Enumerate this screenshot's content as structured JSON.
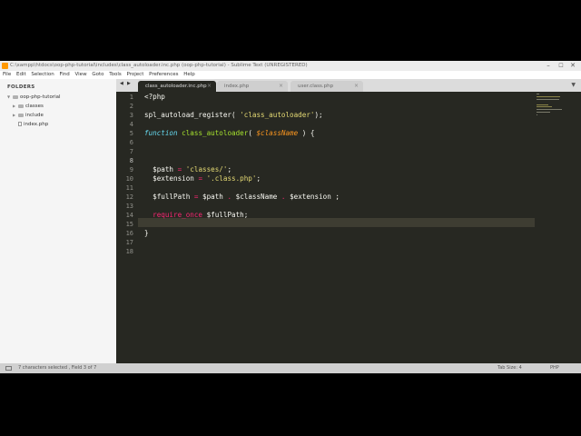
{
  "window": {
    "title": "C:\\xampp\\htdocs\\oop-php-tutorial\\includes\\class_autoloader.inc.php (oop-php-tutorial) - Sublime Text (UNREGISTERED)",
    "controls": {
      "minimize": "–",
      "maximize": "☐",
      "close": "✕"
    }
  },
  "menubar": [
    "File",
    "Edit",
    "Selection",
    "Find",
    "View",
    "Goto",
    "Tools",
    "Project",
    "Preferences",
    "Help"
  ],
  "sidebar": {
    "header": "FOLDERS",
    "root": "oop-php-tutorial",
    "items": [
      {
        "label": "classes",
        "type": "folder"
      },
      {
        "label": "include",
        "type": "folder"
      },
      {
        "label": "index.php",
        "type": "file"
      }
    ]
  },
  "tabs": [
    {
      "label": "class_autoloader.inc.php",
      "active": true
    },
    {
      "label": "index.php",
      "active": false
    },
    {
      "label": "user.class.php",
      "active": false
    }
  ],
  "tab_nav": {
    "left": "◀",
    "right": "▶",
    "menu": "▼",
    "close": "×"
  },
  "editor": {
    "current_line": 8,
    "line_numbers": [
      "1",
      "2",
      "3",
      "4",
      "5",
      "6",
      "7",
      "8",
      "9",
      "10",
      "11",
      "12",
      "13",
      "14",
      "15",
      "16",
      "17",
      "18"
    ],
    "lines": [
      [
        {
          "t": "<?php",
          "c": "white"
        }
      ],
      [],
      [
        {
          "t": "spl_autoload_register",
          "c": "cyan2"
        },
        {
          "t": "( ",
          "c": "white"
        },
        {
          "t": "'class_autoloader'",
          "c": "yellow"
        },
        {
          "t": ");",
          "c": "white"
        }
      ],
      [],
      [
        {
          "t": "function",
          "c": "cyan"
        },
        {
          "t": " ",
          "c": "white"
        },
        {
          "t": "class_autoloader",
          "c": "green"
        },
        {
          "t": "( ",
          "c": "white"
        },
        {
          "t": "$className",
          "c": "orange"
        },
        {
          "t": " ) {",
          "c": "white"
        }
      ],
      [],
      [],
      [],
      [
        {
          "t": "  $path ",
          "c": "white"
        },
        {
          "t": "=",
          "c": "pink"
        },
        {
          "t": " ",
          "c": "white"
        },
        {
          "t": "'classes/'",
          "c": "yellow"
        },
        {
          "t": ";",
          "c": "white"
        }
      ],
      [
        {
          "t": "  $extension ",
          "c": "white"
        },
        {
          "t": "=",
          "c": "pink"
        },
        {
          "t": " ",
          "c": "white"
        },
        {
          "t": "'.class.php'",
          "c": "yellow"
        },
        {
          "t": ";",
          "c": "white"
        }
      ],
      [],
      [
        {
          "t": "  $fullPath ",
          "c": "white"
        },
        {
          "t": "=",
          "c": "pink"
        },
        {
          "t": " $path ",
          "c": "white"
        },
        {
          "t": ".",
          "c": "pink"
        },
        {
          "t": " $className ",
          "c": "white"
        },
        {
          "t": ".",
          "c": "pink"
        },
        {
          "t": " $extension ;",
          "c": "white"
        }
      ],
      [],
      [
        {
          "t": "  require_once",
          "c": "pink"
        },
        {
          "t": " $fullPath;",
          "c": "white"
        }
      ],
      [],
      [
        {
          "t": "}",
          "c": "white"
        }
      ],
      [],
      []
    ]
  },
  "statusbar": {
    "message": "7 characters selected , Field 3 of 7",
    "tab_size": "Tab Size: 4",
    "syntax": "PHP"
  },
  "colors": {
    "background": "#272822",
    "keyword": "#f92672",
    "function_name": "#a6e22e",
    "string": "#e6db74",
    "storage": "#66d9ef",
    "parameter": "#fd971f"
  }
}
